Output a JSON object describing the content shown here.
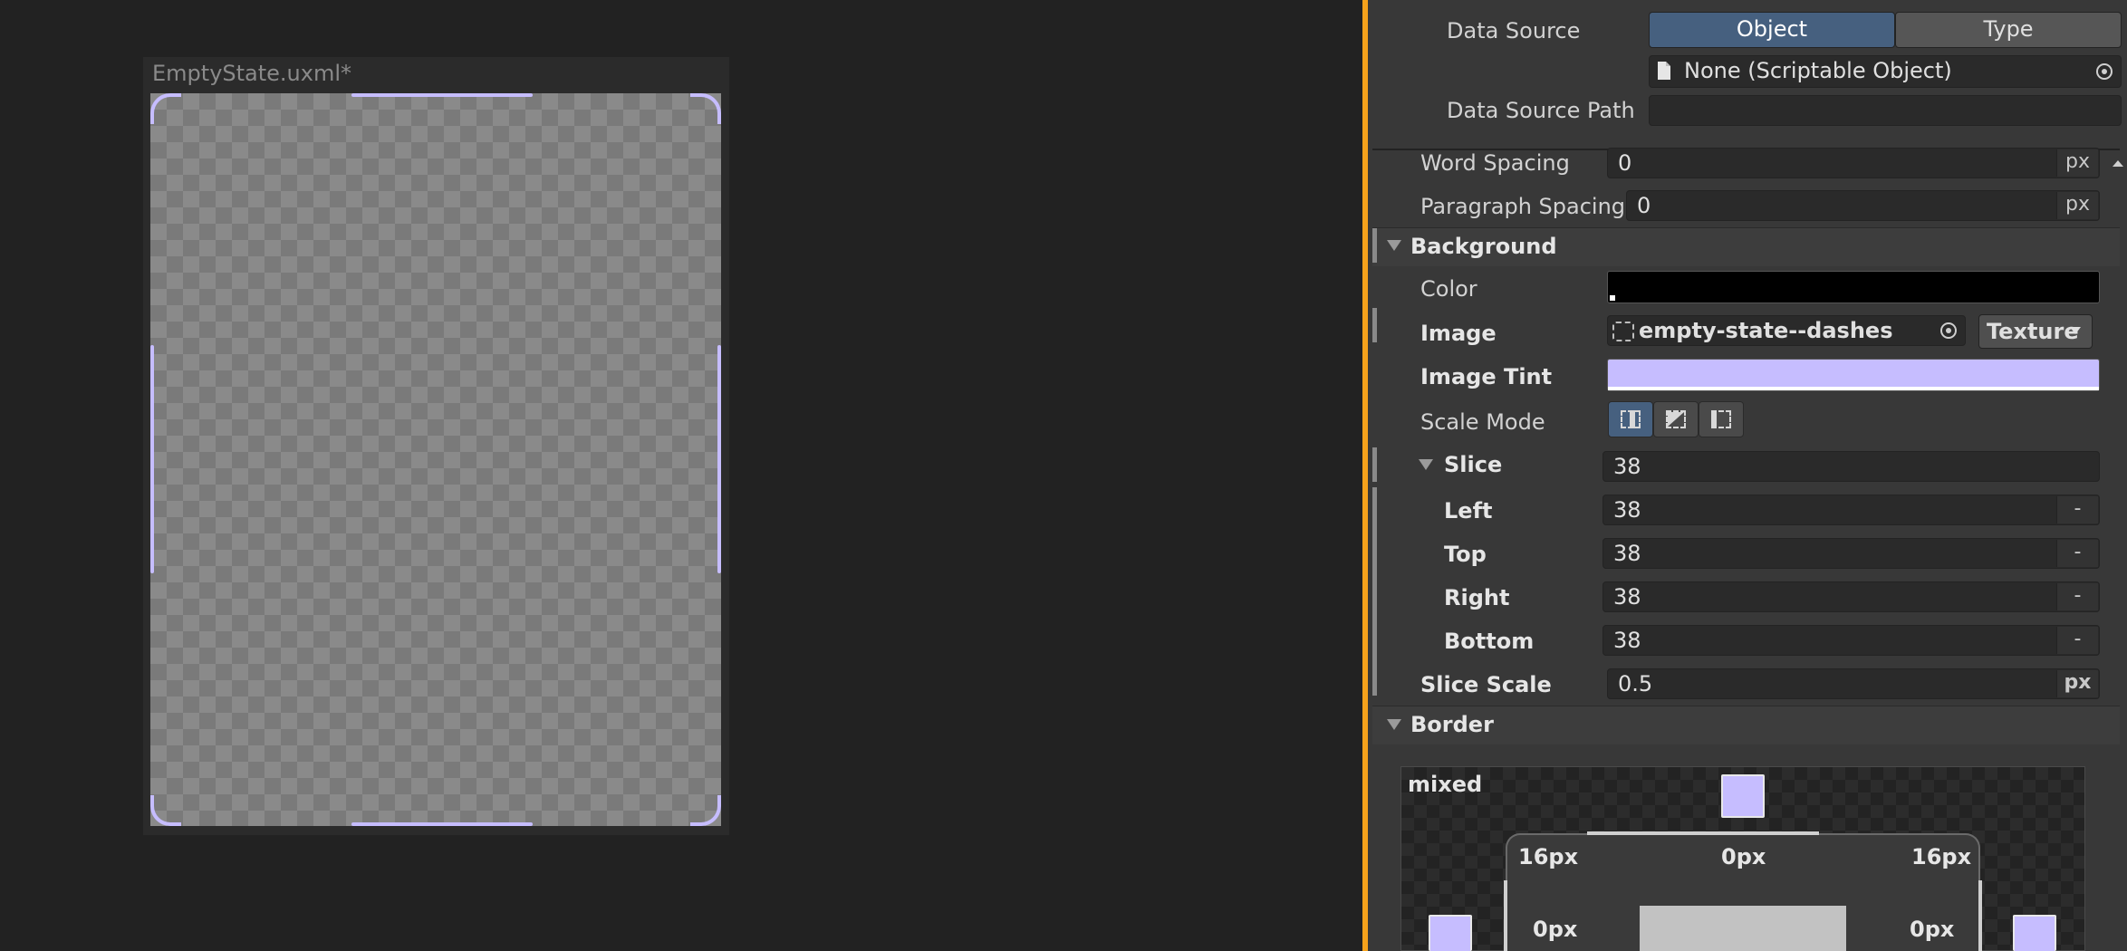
{
  "canvas": {
    "title": "EmptyState.uxml*"
  },
  "inspector": {
    "data_source": {
      "label": "Data Source",
      "toggle_object": "Object",
      "toggle_type": "Type",
      "object_value": "None (Scriptable Object)",
      "path_label": "Data Source Path",
      "path_value": ""
    },
    "text": {
      "word_spacing_label": "Word Spacing",
      "word_spacing_value": "0",
      "word_spacing_unit": "px",
      "paragraph_spacing_label": "Paragraph Spacing",
      "paragraph_spacing_value": "0",
      "paragraph_spacing_unit": "px"
    },
    "background": {
      "header": "Background",
      "color_label": "Color",
      "color_value": "#000000",
      "image_label": "Image",
      "image_value": "empty-state--dashes",
      "image_type": "Texture",
      "tint_label": "Image Tint",
      "tint_value": "#c6bdff",
      "scale_mode_label": "Scale Mode",
      "scale_mode_selected": 0,
      "slice_label": "Slice",
      "slice_value": "38",
      "left_label": "Left",
      "left_value": "38",
      "top_label": "Top",
      "top_value": "38",
      "right_label": "Right",
      "right_value": "38",
      "bottom_label": "Bottom",
      "bottom_value": "38",
      "minus": "-",
      "slice_scale_label": "Slice Scale",
      "slice_scale_value": "0.5",
      "slice_scale_unit": "px"
    },
    "border": {
      "header": "Border",
      "mixed_label": "mixed",
      "top_left_radius": "16px",
      "top_width": "0px",
      "top_right_radius": "16px",
      "left_width": "0px",
      "right_width": "0px",
      "swatch_color": "#c6bdff"
    }
  },
  "colors": {
    "accent_orange": "#f6a21b",
    "toggle_active": "#46607f",
    "dash_color": "#c6bdff"
  }
}
